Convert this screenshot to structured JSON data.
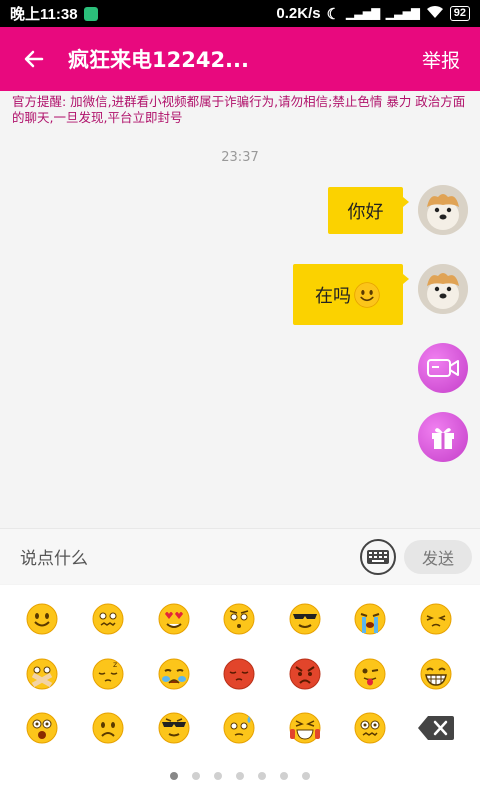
{
  "statusbar": {
    "time": "晚上11:38",
    "net_speed": "0.2K/s",
    "battery": "92"
  },
  "header": {
    "title": "疯狂来电12242...",
    "report_label": "举报"
  },
  "notice": "官方提醒: 加微信,进群看小视频都属于诈骗行为,请勿相信;禁止色情 暴力 政治方面的聊天,一旦发现,平台立即封号",
  "chat": {
    "timestamp": "23:37",
    "messages": [
      {
        "text": "你好",
        "emoji": ""
      },
      {
        "text": "在吗",
        "emoji": "smile-emoji"
      }
    ]
  },
  "input": {
    "placeholder": "说点什么",
    "send_label": "发送"
  },
  "colors": {
    "brand": "#e8097e",
    "bubble": "#fbd200",
    "emoji_face": "#fcc51a"
  },
  "emoji_page": {
    "current": 1,
    "total": 7
  }
}
